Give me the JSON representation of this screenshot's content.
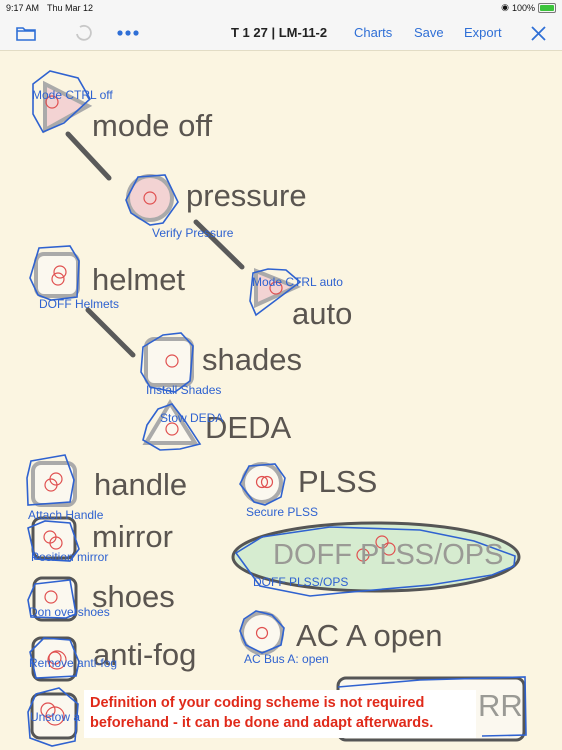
{
  "status_bar": {
    "time": "9:17 AM",
    "date": "Thu Mar 12",
    "battery": "100%",
    "battery_level": 1.0
  },
  "toolbar": {
    "title": "T 1   27 | LM-11-2",
    "charts_label": "Charts",
    "save_label": "Save",
    "export_label": "Export",
    "icons": [
      "folder-icon",
      "undo-icon",
      "more-icon",
      "close-icon"
    ]
  },
  "nodes": [
    {
      "word": "mode off",
      "label": "Mode CTRL off",
      "shape": "triangle"
    },
    {
      "word": "pressure",
      "label": "Verify Pressure",
      "shape": "circle"
    },
    {
      "word": "auto",
      "label": "Mode CTRL auto",
      "shape": "triangle"
    },
    {
      "word": "helmet",
      "label": "DOFF Helmets",
      "shape": "square"
    },
    {
      "word": "shades",
      "label": "Install Shades",
      "shape": "square"
    },
    {
      "word": "DEDA",
      "label": "Stow DEDA",
      "shape": "triangle"
    },
    {
      "word": "handle",
      "label": "Attach Handle",
      "shape": "square"
    },
    {
      "word": "PLSS",
      "label": "Secure PLSS",
      "shape": "circle"
    },
    {
      "word": "mirror",
      "label": "Position mirror",
      "shape": "square"
    },
    {
      "word": "DOFF PLSS/OPS",
      "label": "DOFF PLSS/OPS",
      "shape": "ellipse"
    },
    {
      "word": "shoes",
      "label": "Don overshoes",
      "shape": "square"
    },
    {
      "word": "anti-fog",
      "label": "Remove anti-fog",
      "shape": "square"
    },
    {
      "word": "AC A open",
      "label": "AC Bus A: open",
      "shape": "circle"
    },
    {
      "word": "RR",
      "label": "Unstow a",
      "shape": "square"
    }
  ],
  "note": {
    "line1": "Definition of your coding scheme is not required",
    "line2": "beforehand - it can be done and adapt afterwards."
  },
  "colors": {
    "accent": "#2f6fd6",
    "background": "#fbf5e1",
    "note_text": "#e02a1a",
    "highlight_fill": "#f3d3d3",
    "ellipse_fill": "#d6ecd0"
  }
}
